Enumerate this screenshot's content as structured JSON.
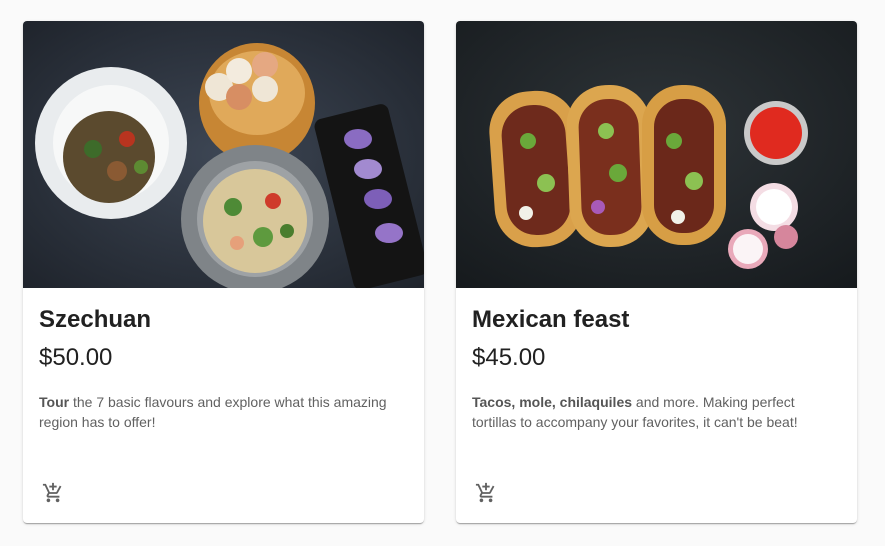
{
  "cards": [
    {
      "title": "Szechuan",
      "price": "$50.00",
      "desc_bold": "Tour",
      "desc_rest": " the 7 basic flavours and explore what this amazing region has to offer!",
      "cart_icon": "add-shopping-cart-icon"
    },
    {
      "title": "Mexican feast",
      "price": "$45.00",
      "desc_bold": "Tacos, mole, chilaquiles",
      "desc_rest": " and more. Making perfect tortillas to accompany your favorites, it can't be beat!",
      "cart_icon": "add-shopping-cart-icon"
    }
  ],
  "colors": {
    "page_bg": "#fafafa",
    "card_bg": "#ffffff",
    "text": "#212121",
    "muted": "#616161"
  }
}
